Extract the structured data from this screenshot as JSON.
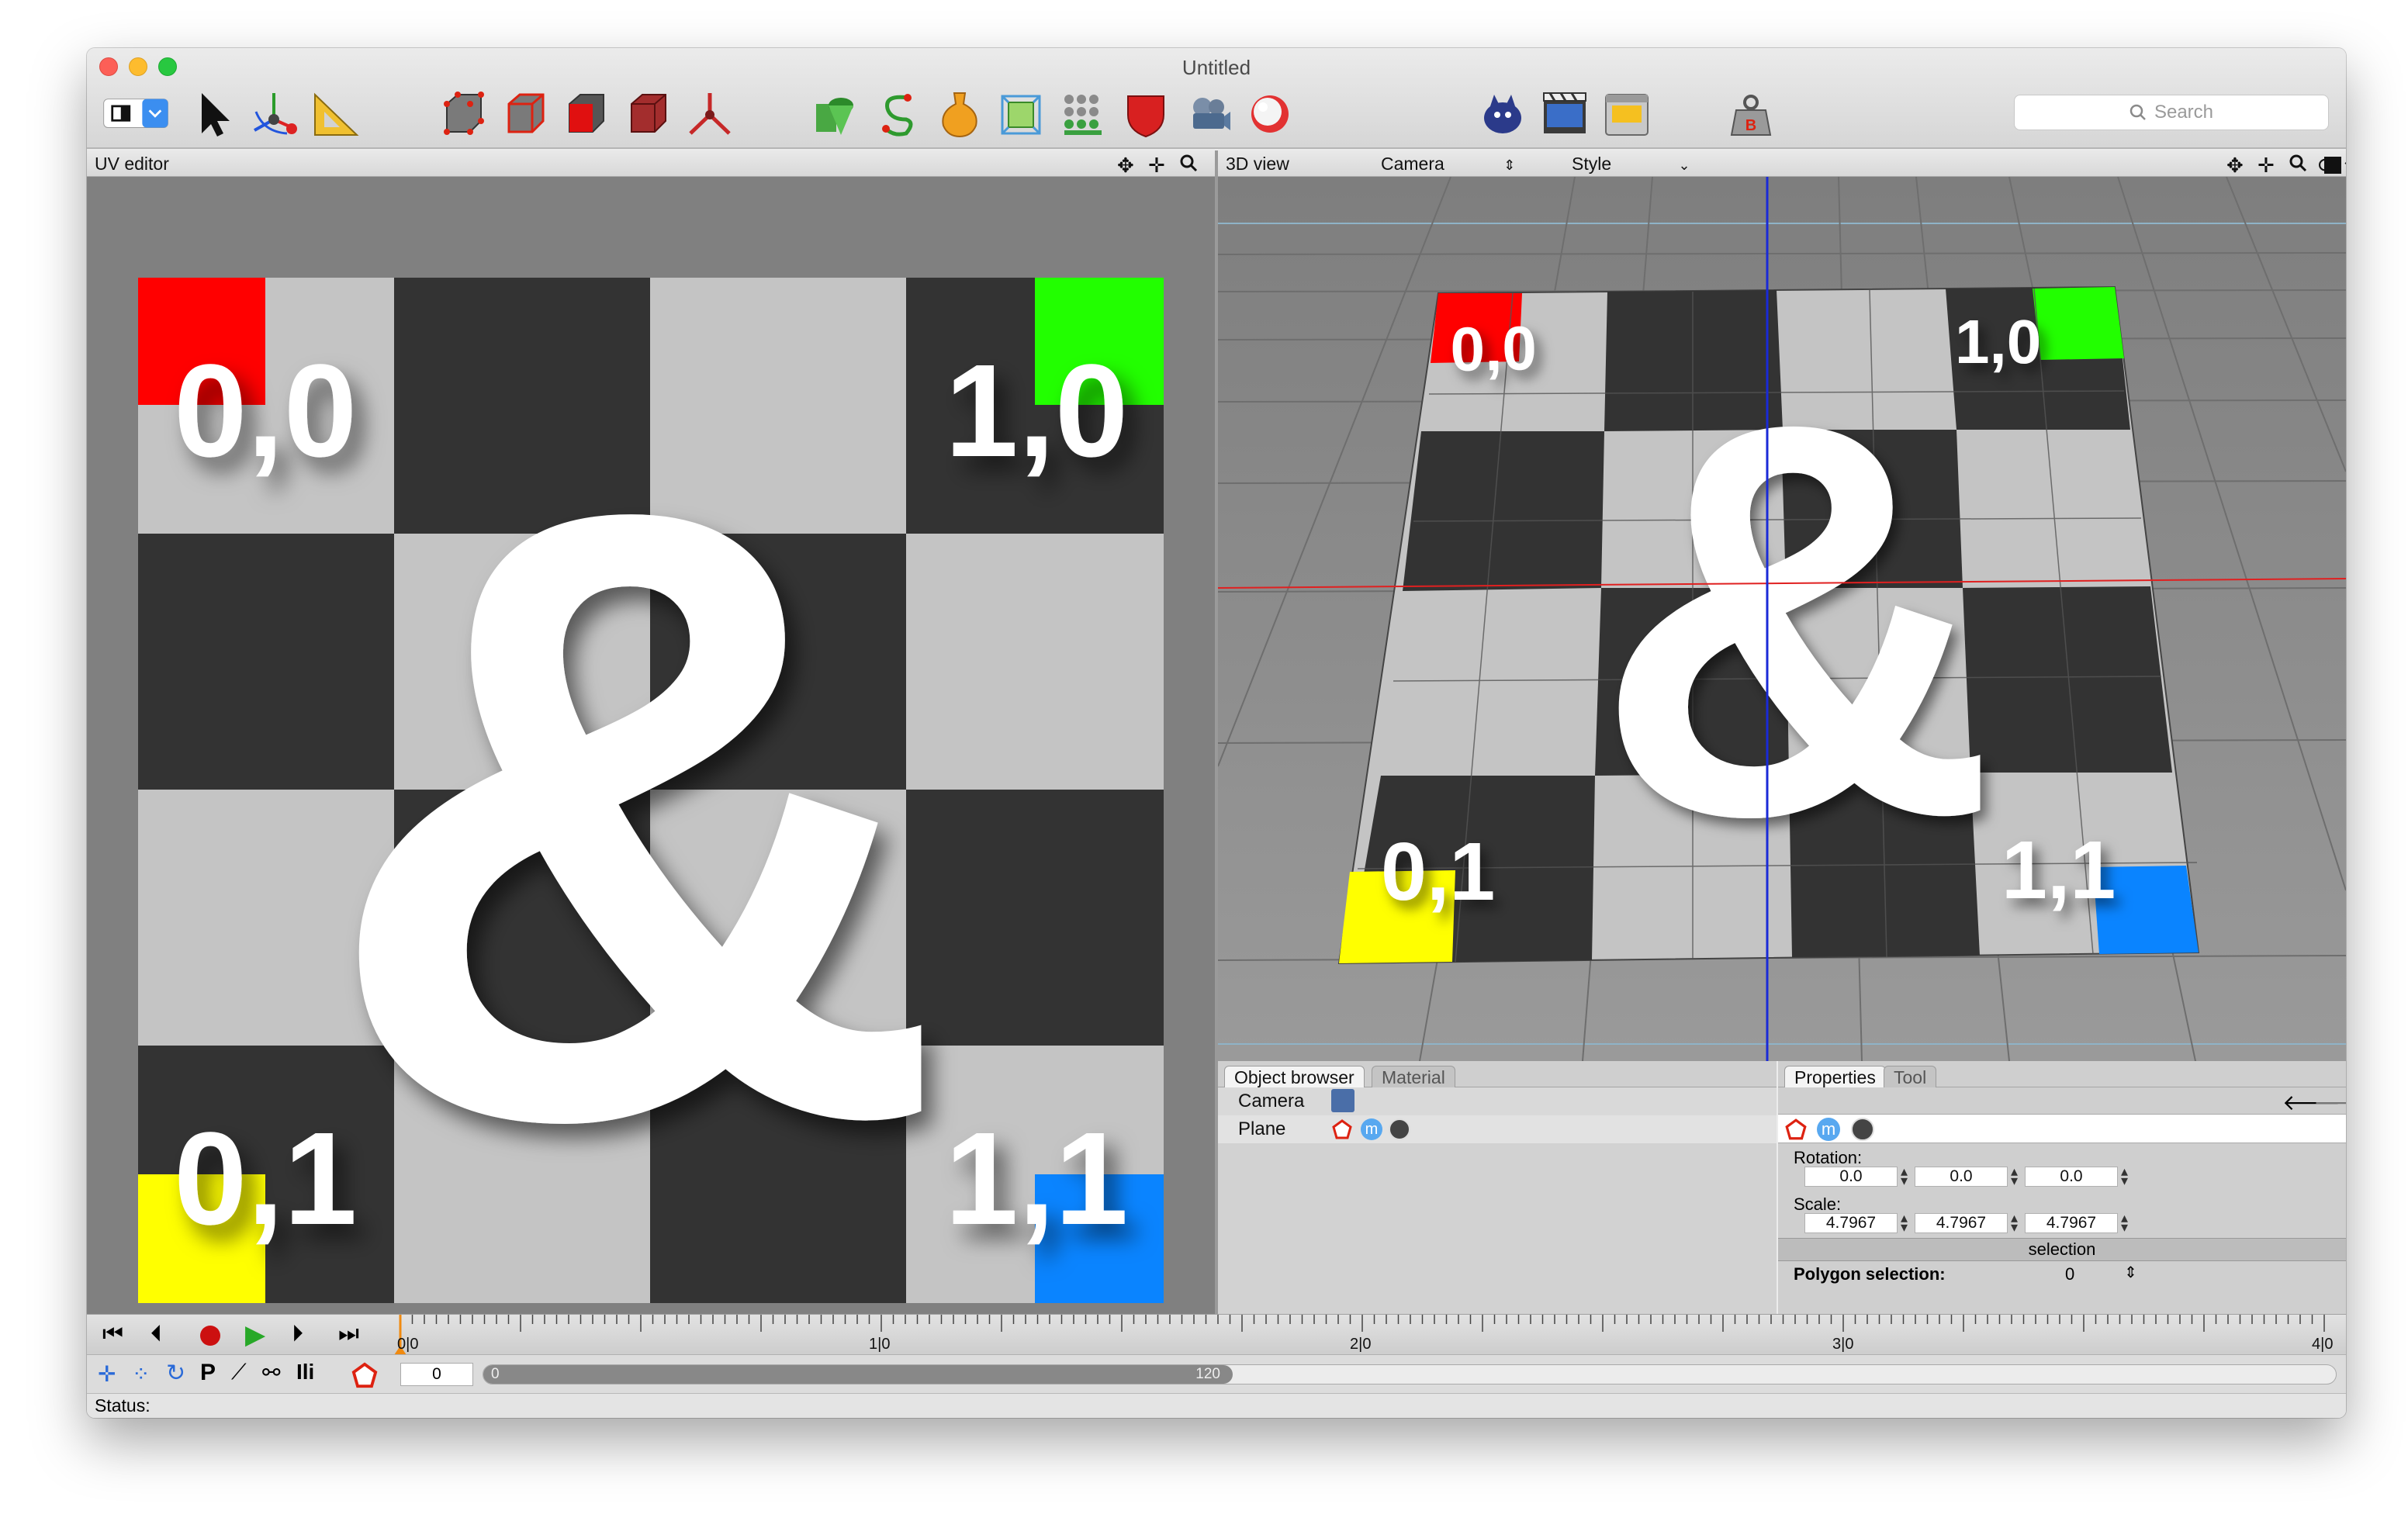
{
  "window": {
    "title": "Untitled"
  },
  "toolbar": {
    "search_placeholder": "Search",
    "tools": [
      "layout-selector-icon",
      "select-arrow-icon",
      "transform-axes-icon",
      "measure-ruler-icon",
      "vertex-mode-icon",
      "edge-mode-icon",
      "face-mode-icon",
      "object-mode-icon",
      "joint-mode-icon",
      "primitives-icon",
      "spline-icon",
      "lathe-icon",
      "deformer-icon",
      "particles-icon",
      "shield-icon",
      "camera-lights-icon",
      "sphere-render-icon",
      "creature-icon",
      "clapperboard-icon",
      "render-oven-icon",
      "physics-weight-icon"
    ]
  },
  "uv_editor": {
    "title": "UV editor",
    "corner_labels": {
      "top_left": "0,0",
      "top_right": "1,0",
      "bottom_left": "0,1",
      "bottom_right": "1,1"
    },
    "glyph": "&"
  },
  "view3d": {
    "title": "3D view",
    "camera_label": "Camera",
    "style_label": "Style"
  },
  "object_browser": {
    "tabs": [
      "Object browser",
      "Material"
    ],
    "objects": [
      {
        "name": "Camera"
      },
      {
        "name": "Plane"
      }
    ]
  },
  "properties": {
    "tabs": [
      "Properties",
      "Tool"
    ],
    "rotation_label": "Rotation:",
    "rotation": [
      "0.0",
      "0.0",
      "0.0"
    ],
    "scale_label": "Scale:",
    "scale": [
      "4.7967",
      "4.7967",
      "4.7967"
    ],
    "selection_header": "selection",
    "polygon_selection_label": "Polygon selection:",
    "polygon_selection_value": "0"
  },
  "timeline": {
    "markers": [
      "0|0",
      "1|0",
      "2|0",
      "3|0",
      "4|0"
    ],
    "frame_field": "0",
    "range_start": "0",
    "range_end": "120"
  },
  "status": {
    "label": "Status:"
  },
  "colors": {
    "red": "#ff0000",
    "green": "#22ff00",
    "yellow": "#ffff00",
    "blue": "#0a84ff",
    "dark": "#333333",
    "light": "#c4c4c4"
  }
}
